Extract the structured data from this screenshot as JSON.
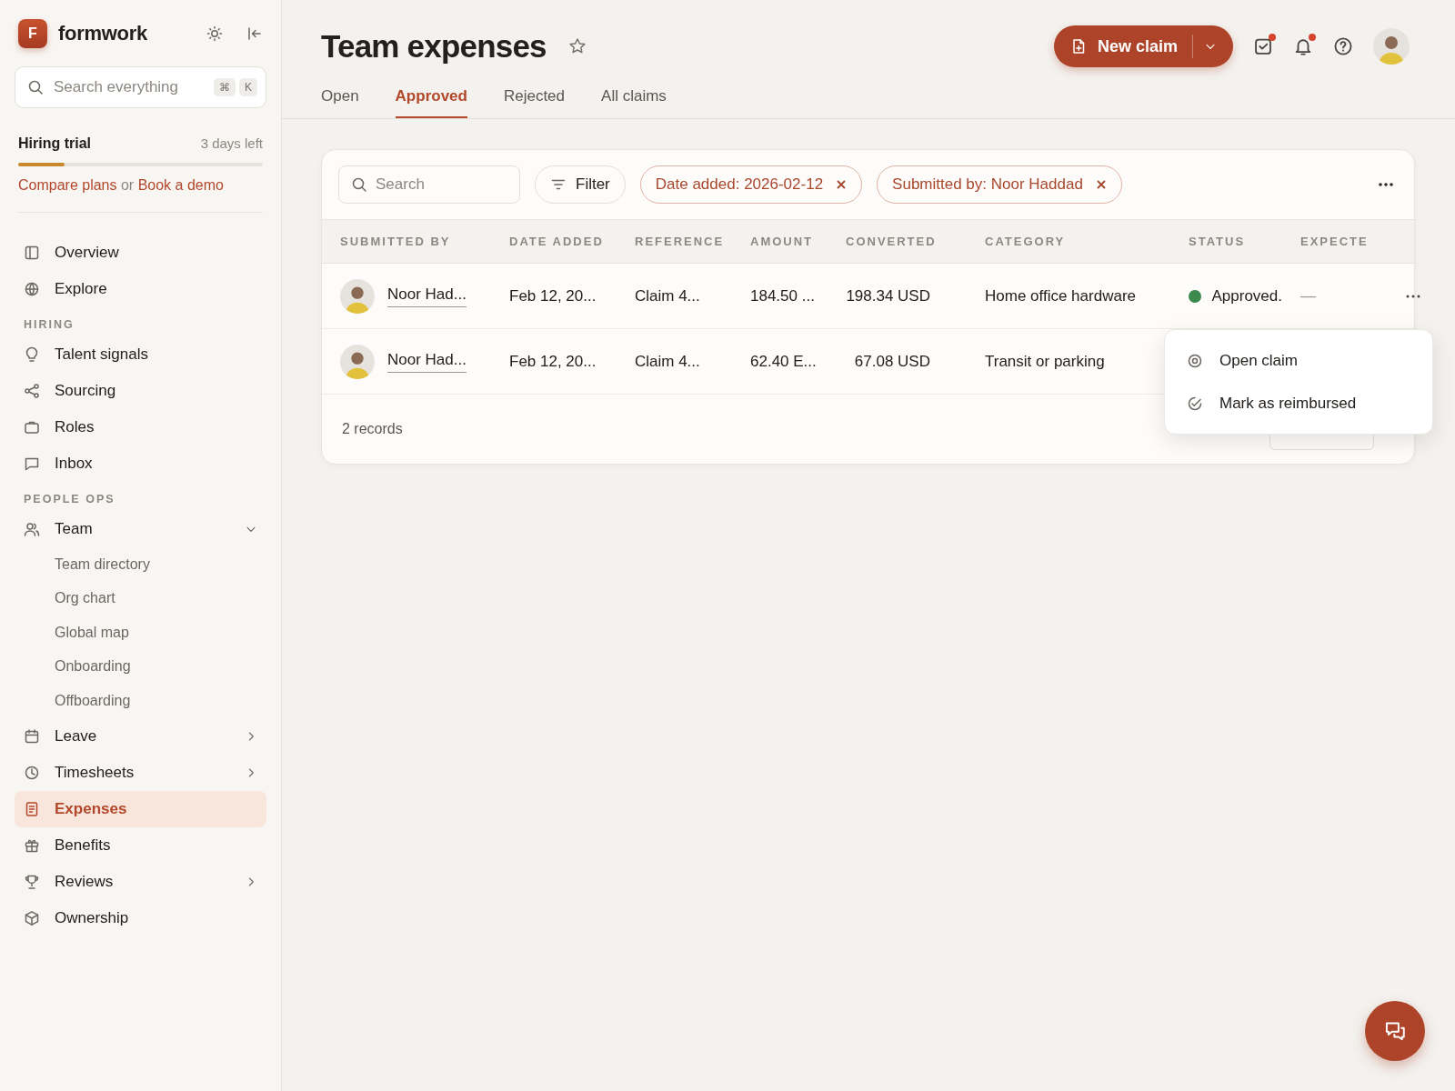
{
  "app": {
    "logo_letter": "F",
    "name": "formwork"
  },
  "search": {
    "placeholder": "Search everything",
    "shortcut": [
      "⌘",
      "K"
    ]
  },
  "trial": {
    "title": "Hiring trial",
    "remaining": "3 days left",
    "level": 0.19,
    "compare_link": "Compare plans",
    "joiner": "or",
    "demo_link": "Book a demo"
  },
  "nav": [
    {
      "kind": "item",
      "label": "Overview",
      "selected": false
    },
    {
      "kind": "item",
      "label": "Explore",
      "selected": false
    },
    {
      "kind": "section",
      "label": "HIRING"
    },
    {
      "kind": "item",
      "label": "Talent signals",
      "selected": false
    },
    {
      "kind": "item",
      "label": "Sourcing",
      "selected": false
    },
    {
      "kind": "item",
      "label": "Roles",
      "selected": false
    },
    {
      "kind": "item",
      "label": "Inbox",
      "selected": false
    },
    {
      "kind": "section",
      "label": "PEOPLE OPS"
    },
    {
      "kind": "item",
      "label": "Team",
      "selected": false,
      "expanded": true,
      "children": [
        {
          "label": "Team directory",
          "selected": false
        },
        {
          "label": "Org chart",
          "selected": false
        },
        {
          "label": "Global map",
          "selected": false
        },
        {
          "label": "Onboarding",
          "selected": false
        },
        {
          "label": "Offboarding",
          "selected": false
        }
      ]
    },
    {
      "kind": "item",
      "label": "Leave",
      "selected": false,
      "expanded": false
    },
    {
      "kind": "item",
      "label": "Timesheets",
      "selected": false,
      "expanded": false
    },
    {
      "kind": "item",
      "label": "Expenses",
      "selected": true
    },
    {
      "kind": "item",
      "label": "Benefits",
      "selected": false
    },
    {
      "kind": "item",
      "label": "Reviews",
      "selected": false,
      "expanded": false
    },
    {
      "kind": "item",
      "label": "Ownership",
      "selected": false
    }
  ],
  "header": {
    "title": "Team expenses",
    "starred": false,
    "primary_button": "New claim",
    "tasks_unread": true,
    "notifications_unread": true
  },
  "tabs": [
    {
      "label": "Open",
      "selected": false
    },
    {
      "label": "Approved",
      "selected": true
    },
    {
      "label": "Rejected",
      "selected": false
    },
    {
      "label": "All claims",
      "selected": false
    }
  ],
  "filters": {
    "search_placeholder": "Search",
    "filter_button": "Filter",
    "chips": [
      {
        "label": "Date added: 2026-02-12"
      },
      {
        "label": "Submitted by: Noor Haddad"
      }
    ]
  },
  "table": {
    "columns": [
      "SUBMITTED BY",
      "DATE ADDED",
      "REFERENCE",
      "AMOUNT",
      "CONVERTED",
      "CATEGORY",
      "STATUS",
      "EXPECTE"
    ],
    "rows": [
      {
        "submitted_by": "Noor Had...",
        "date_added": "Feb 12, 20...",
        "reference": "Claim 4...",
        "amount": "184.50 ...",
        "converted": "198.34 USD",
        "category": "Home office hardware",
        "status": {
          "kind": "approved",
          "label": "Approved."
        },
        "expected": "—",
        "has_actions": true
      },
      {
        "submitted_by": "Noor Had...",
        "date_added": "Feb 12, 20...",
        "reference": "Claim 4...",
        "amount": "62.40 E...",
        "converted": "67.08 USD",
        "category": "Transit or parking",
        "has_actions": false
      }
    ],
    "footer": "2 records"
  },
  "row_menu": [
    {
      "label": "Open claim"
    },
    {
      "label": "Mark as reimbursed"
    }
  ]
}
